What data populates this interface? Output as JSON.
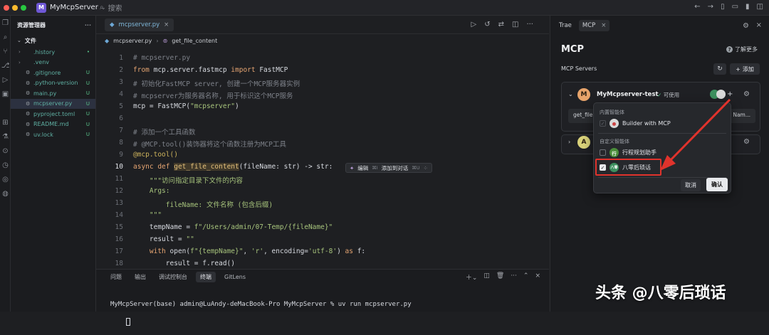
{
  "titlebar": {
    "project_initial": "M",
    "project_name": "MyMcpServer",
    "search_placeholder": "搜索"
  },
  "explorer": {
    "title": "资源管理器",
    "root": "文件",
    "items": [
      {
        "name": ".history",
        "status": "•",
        "folder": true
      },
      {
        "name": ".venv",
        "status": "",
        "folder": true
      },
      {
        "name": ".gitignore",
        "status": "U",
        "folder": false
      },
      {
        "name": ".python-version",
        "status": "U",
        "folder": false
      },
      {
        "name": "main.py",
        "status": "U",
        "folder": false
      },
      {
        "name": "mcpserver.py",
        "status": "U",
        "folder": false,
        "selected": true
      },
      {
        "name": "pyproject.toml",
        "status": "U",
        "folder": false
      },
      {
        "name": "README.md",
        "status": "U",
        "folder": false
      },
      {
        "name": "uv.lock",
        "status": "U",
        "folder": false
      }
    ]
  },
  "editor": {
    "tab": "mcpserver.py",
    "breadcrumb": [
      "mcpserver.py",
      "get_file_content"
    ],
    "inline_actions": {
      "edit": "编辑",
      "edit_key": "⌘I",
      "add_chat": "添加到对话",
      "add_chat_key": "⌘U"
    },
    "lines": [
      {
        "n": "1",
        "text": "# mcpserver.py"
      },
      {
        "n": "2",
        "text": "from mcp.server.fastmcp import FastMCP"
      },
      {
        "n": "3",
        "text": "# 初始化FastMCP server, 创建一个MCP服务器实例"
      },
      {
        "n": "4",
        "text": "# mcpserver为服务器名称, 用于标识这个MCP服务"
      },
      {
        "n": "5",
        "text": "mcp = FastMCP(\"mcpserver\")"
      },
      {
        "n": "6",
        "text": ""
      },
      {
        "n": "7",
        "text": "# 添加一个工具函数"
      },
      {
        "n": "8",
        "text": "# @MCP.tool()装饰器将这个函数注册为MCP工具"
      },
      {
        "n": "9",
        "text": "@mcp.tool()"
      },
      {
        "n": "10",
        "text": "async def get_file_content(fileName: str) -> str:"
      },
      {
        "n": "11",
        "text": "    \"\"\"访问指定目录下文件的内容"
      },
      {
        "n": "12",
        "text": "    Args:"
      },
      {
        "n": "13",
        "text": "        fileName: 文件名称 (包含后缀)"
      },
      {
        "n": "14",
        "text": "    \"\"\""
      },
      {
        "n": "15",
        "text": "    tempName = f\"/Users/admin/07-Temp/{fileName}\""
      },
      {
        "n": "16",
        "text": "    result = \"\""
      },
      {
        "n": "17",
        "text": "    with open(f\"{tempName}\", 'r', encoding='utf-8') as f:"
      },
      {
        "n": "18",
        "text": "        result = f.read()"
      }
    ]
  },
  "panel": {
    "tabs": [
      "问题",
      "输出",
      "调试控制台",
      "终端",
      "GitLens"
    ],
    "active_tab": "终端",
    "terminal_line": "MyMcpServer(base) admin@LuAndy-deMacBook-Pro MyMcpServer % uv run mcpserver.py"
  },
  "right": {
    "tabs": [
      "Trae",
      "MCP"
    ],
    "title": "MCP",
    "learn_more": "了解更多",
    "servers_label": "MCP Servers",
    "add_label": "添加",
    "server1": {
      "initial": "M",
      "name": "MyMcpserver-test",
      "status": "可使用",
      "tool": "get_file",
      "tool_right": "Nam..."
    },
    "server2": {
      "initial": "A"
    },
    "dropdown": {
      "builtin_section": "内置智能体",
      "builtin_agent": "Builder with MCP",
      "custom_section": "自定义智能体",
      "custom_agents": [
        {
          "initial": "行",
          "name": "行程规划助手",
          "checked": false
        },
        {
          "initial": "八零",
          "name": "八零后琐话",
          "checked": true
        }
      ],
      "cancel": "取消",
      "confirm": "确认"
    }
  },
  "watermark": "头条 @八零后琐话"
}
